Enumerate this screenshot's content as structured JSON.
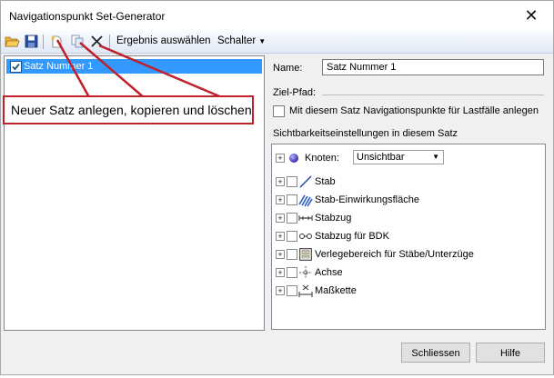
{
  "window": {
    "title": "Navigationspunkt Set-Generator"
  },
  "toolbar": {
    "icons": [
      "open-folder-icon",
      "save-icon",
      "new-set-icon",
      "copy-set-icon",
      "delete-icon"
    ],
    "result_label": "Ergebnis auswählen",
    "switch_label": "Schalter"
  },
  "sets": [
    {
      "label": "Satz Nummer 1",
      "checked": true,
      "selected": true
    }
  ],
  "annotation": {
    "text": "Neuer Satz anlegen, kopieren und löschen",
    "color": "#c0202a"
  },
  "form": {
    "name_label": "Name:",
    "name_value": "Satz Nummer 1",
    "path_label": "Ziel-Pfad:",
    "loadcase_checkbox_label": "Mit diesem Satz Navigationspunkte für Lastfälle anlegen",
    "visibility_heading": "Sichtbarkeitseinstellungen in diesem Satz"
  },
  "tree": {
    "first": {
      "label": "Knoten:",
      "icon": "node-sphere-icon",
      "select_value": "Unsichtbar"
    },
    "items": [
      {
        "label": "Stab",
        "icon": "bar-line-icon"
      },
      {
        "label": "Stab-Einwirkungsfläche",
        "icon": "bar-load-area-icon"
      },
      {
        "label": "Stabzug",
        "icon": "bar-chain-icon"
      },
      {
        "label": "Stabzug für BDK",
        "icon": "bar-chain-bdk-icon"
      },
      {
        "label": "Verlegebereich für Stäbe/Unterzüge",
        "icon": "layout-area-icon"
      },
      {
        "label": "Achse",
        "icon": "axis-icon"
      },
      {
        "label": "Maßkette",
        "icon": "dimension-chain-icon"
      }
    ]
  },
  "buttons": {
    "close_label": "Schliessen",
    "help_label": "Hilfe"
  }
}
